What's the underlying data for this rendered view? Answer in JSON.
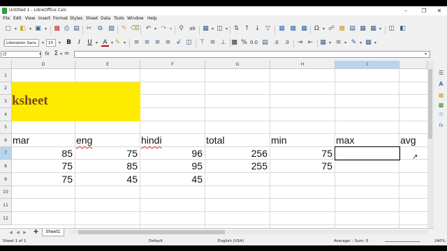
{
  "window": {
    "title": "Untitled 1 - LibreOffice Calc",
    "minimize": "–",
    "maximize": "❐",
    "close": "✕"
  },
  "menu": [
    "File",
    "Edit",
    "View",
    "Insert",
    "Format",
    "Styles",
    "Sheet",
    "Data",
    "Tools",
    "Window",
    "Help"
  ],
  "toolbar": {
    "font_name": "Liberation Sans",
    "font_size": "10",
    "bold": "B",
    "italic": "I",
    "underline": "U",
    "font_color_letter": "A",
    "percent": "%",
    "decimal": "0.0",
    "omega": "Ω"
  },
  "formula_bar": {
    "name_box": "I7",
    "function_wizard": "fx",
    "sum": "Σ",
    "equals": "=",
    "content": ""
  },
  "columns": [
    "D",
    "E",
    "F",
    "G",
    "H",
    "I"
  ],
  "selected_column": "I",
  "rows": [
    "1",
    "2",
    "3",
    "4",
    "5",
    "6",
    "7",
    "8",
    "9",
    "10",
    "11",
    "12"
  ],
  "selected_row": "7",
  "sheet": {
    "title_fragment": "ksheet",
    "headers": [
      "mar",
      "eng",
      "hindi",
      "total",
      "min",
      "max",
      "avg"
    ],
    "data": [
      {
        "mar": "85",
        "eng": "75",
        "hindi": "96",
        "total": "256",
        "min": "75"
      },
      {
        "mar": "75",
        "eng": "85",
        "hindi": "95",
        "total": "255",
        "min": "75"
      },
      {
        "mar": "75",
        "eng": "45",
        "hindi": "45"
      }
    ],
    "accent_color": "#ffeb00"
  },
  "tabs": {
    "add": "+",
    "active": "Sheet1"
  },
  "status": {
    "sheet_info": "Sheet 1 of 1",
    "page_style": "Default",
    "language": "English (USA)",
    "aggregate": "Average: ; Sum: 0",
    "zoom": "240%"
  }
}
